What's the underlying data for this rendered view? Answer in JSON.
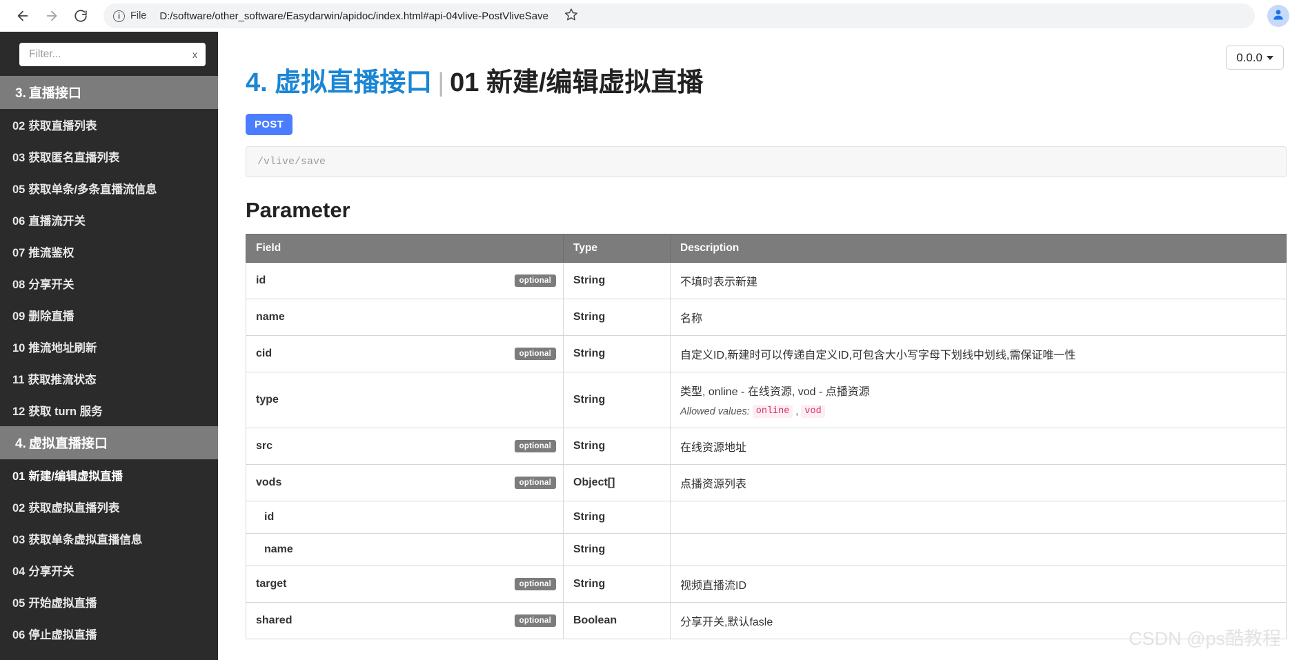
{
  "browser": {
    "back_icon": "arrow-left-icon",
    "forward_icon": "arrow-right-icon",
    "reload_icon": "reload-icon",
    "info_icon": "info-circle-icon",
    "file_label": "File",
    "url": "D:/software/other_software/Easydarwin/apidoc/index.html#api-04vlive-PostVliveSave",
    "bookmark_icon": "star-icon",
    "profile_icon": "profile-avatar-icon"
  },
  "sidebar": {
    "filter": {
      "placeholder": "Filter...",
      "value": "",
      "clear_label": "x"
    },
    "groups": [
      {
        "num": "3.",
        "label": "直播接口",
        "active": true,
        "items": [
          {
            "num": "02",
            "label": "获取直播列表"
          },
          {
            "num": "03",
            "label": "获取匿名直播列表"
          },
          {
            "num": "05",
            "label": "获取单条/多条直播流信息"
          },
          {
            "num": "06",
            "label": "直播流开关"
          },
          {
            "num": "07",
            "label": "推流鉴权"
          },
          {
            "num": "08",
            "label": "分享开关"
          },
          {
            "num": "09",
            "label": "删除直播"
          },
          {
            "num": "10",
            "label": "推流地址刷新"
          },
          {
            "num": "11",
            "label": "获取推流状态"
          },
          {
            "num": "12",
            "label": "获取 turn 服务"
          }
        ]
      },
      {
        "num": "4.",
        "label": "虚拟直播接口",
        "active": true,
        "items": [
          {
            "num": "01",
            "label": "新建/编辑虚拟直播"
          },
          {
            "num": "02",
            "label": "获取虚拟直播列表"
          },
          {
            "num": "03",
            "label": "获取单条虚拟直播信息"
          },
          {
            "num": "04",
            "label": "分享开关"
          },
          {
            "num": "05",
            "label": "开始虚拟直播"
          },
          {
            "num": "06",
            "label": "停止虚拟直播"
          }
        ]
      }
    ]
  },
  "main": {
    "version": "0.0.0",
    "title_group": "4. 虚拟直播接口",
    "title_sep": "|",
    "title_name": "01 新建/编辑虚拟直播",
    "method": "POST",
    "endpoint": "/vlive/save",
    "section_title": "Parameter",
    "table": {
      "headers": [
        "Field",
        "Type",
        "Description"
      ],
      "rows": [
        {
          "field": "id",
          "optional": "optional",
          "type": "String",
          "desc": "不填时表示新建",
          "nested": false
        },
        {
          "field": "name",
          "optional": "",
          "type": "String",
          "desc": "名称",
          "nested": false
        },
        {
          "field": "cid",
          "optional": "optional",
          "type": "String",
          "desc": "自定义ID,新建时可以传递自定义ID,可包含大小写字母下划线中划线,需保证唯一性",
          "nested": false
        },
        {
          "field": "type",
          "optional": "",
          "type": "String",
          "desc": "类型, online - 在线资源, vod - 点播资源",
          "nested": false,
          "allowed_label": "Allowed values:",
          "allowed_values": [
            "online",
            "vod"
          ]
        },
        {
          "field": "src",
          "optional": "optional",
          "type": "String",
          "desc": "在线资源地址",
          "nested": false
        },
        {
          "field": "vods",
          "optional": "optional",
          "type": "Object[]",
          "desc": "点播资源列表",
          "nested": false
        },
        {
          "field": "id",
          "optional": "",
          "type": "String",
          "desc": "",
          "nested": true
        },
        {
          "field": "name",
          "optional": "",
          "type": "String",
          "desc": "",
          "nested": true
        },
        {
          "field": "target",
          "optional": "optional",
          "type": "String",
          "desc": "视频直播流ID",
          "nested": false
        },
        {
          "field": "shared",
          "optional": "optional",
          "type": "Boolean",
          "desc": "分享开关,默认fasle",
          "nested": false
        }
      ]
    }
  },
  "watermark": "CSDN @ps酷教程",
  "colors": {
    "accent_blue": "#1b86d4",
    "method_blue": "#4a7dff",
    "sidebar_bg": "#2b2b2b",
    "group_header_bg": "#7c7c7c",
    "allowed_code": "#d6336c"
  }
}
